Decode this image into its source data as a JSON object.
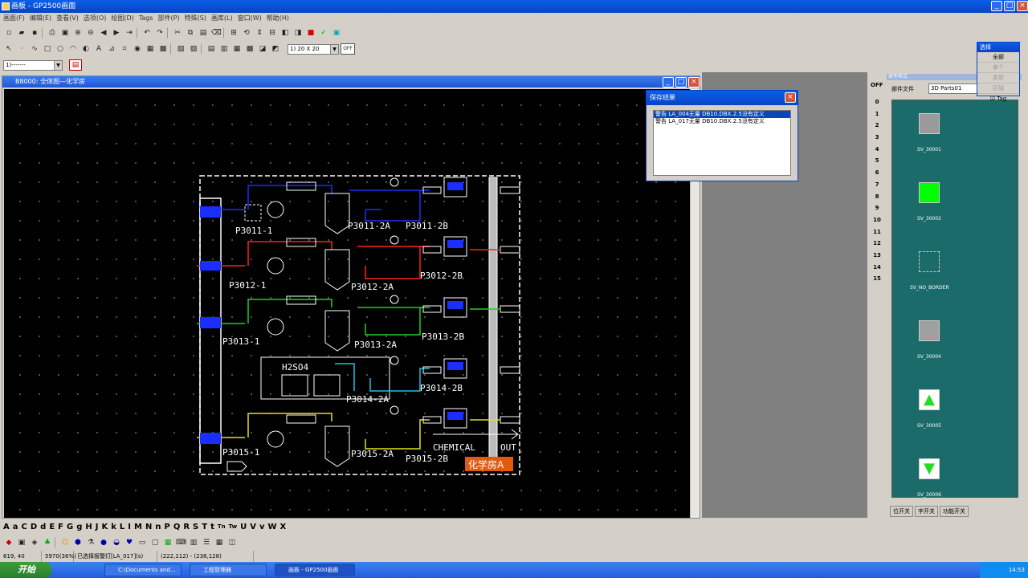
{
  "app": {
    "title": "画板 - GP2500画面"
  },
  "menu": [
    "画面(F)",
    "编辑(E)",
    "查看(V)",
    "选项(O)",
    "绘图(D)",
    "Tags",
    "部件(P)",
    "特殊(S)",
    "画库(L)",
    "窗口(W)",
    "帮助(H)"
  ],
  "toolbar": {
    "line_style": "1)-------",
    "grid_combo": "1) 20 X 20",
    "off_label": "OFF"
  },
  "child_window": {
    "title": "B8000: 全体图—化学房"
  },
  "dialog": {
    "title": "保存结果",
    "items": [
      "警告 LA_004无量 DB10.DBX.2.5没有定义",
      "警告 LA_017无量 DB10.DBX.2.5没有定义"
    ]
  },
  "select_box": {
    "title": "选择",
    "all": "全部",
    "r1": "单个",
    "r2": "类型",
    "r3": "区域",
    "tag": "Tag"
  },
  "right_panel": {
    "header": "部件样式",
    "off": "OFF",
    "file_label": "部件文件",
    "file_value": "3D Parts01",
    "numbers": [
      "0",
      "1",
      "2",
      "3",
      "4",
      "5",
      "6",
      "7",
      "8",
      "9",
      "10",
      "11",
      "12",
      "13",
      "14",
      "15"
    ],
    "parts": [
      {
        "name": "SV_30001",
        "color": "#9a9a9a"
      },
      {
        "name": "SV_30002",
        "color": "#00ff00"
      },
      {
        "name": "SV_NO_BORDER",
        "color": "transparent"
      },
      {
        "name": "SV_30004",
        "color": "#a0a0a0"
      },
      {
        "name": "SV_30005",
        "color": "#22dd22"
      },
      {
        "name": "SV_30006",
        "color": "#22dd22"
      }
    ],
    "tabs": [
      "位开关",
      "字开关",
      "功能开关"
    ]
  },
  "diagram": {
    "pumps": [
      "P3011-1",
      "P3011-2A",
      "P3011-2B",
      "P3012-1",
      "P3012-2A",
      "P3012-2B",
      "P3013-1",
      "P3013-2A",
      "P3013-2B",
      "P3014-2A",
      "P3014-2B",
      "P3015-1",
      "P3015-2A",
      "P3015-2B"
    ],
    "tank_label": "H2SO4",
    "chemical": "CHEMICAL",
    "out": "OUT",
    "room_label": "化学房A"
  },
  "letters": [
    "A",
    "a",
    "C",
    "D",
    "d",
    "E",
    "F",
    "G",
    "g",
    "H",
    "J",
    "K",
    "k",
    "L",
    "I",
    "M",
    "N",
    "n",
    "P",
    "Q",
    "R",
    "S",
    "T",
    "t",
    "Tn",
    "Tw",
    "U",
    "V",
    "v",
    "W",
    "X"
  ],
  "status": [
    "619, 40",
    "5970(36%)",
    "已选择报警灯[LA_017](s)",
    "(222,112) - (238,128)"
  ],
  "taskbar": {
    "start": "开始",
    "tasks": [
      "C:\\Documents and...",
      "工程管理器",
      "画板 - GP2500画面"
    ],
    "clock": "14:53"
  }
}
